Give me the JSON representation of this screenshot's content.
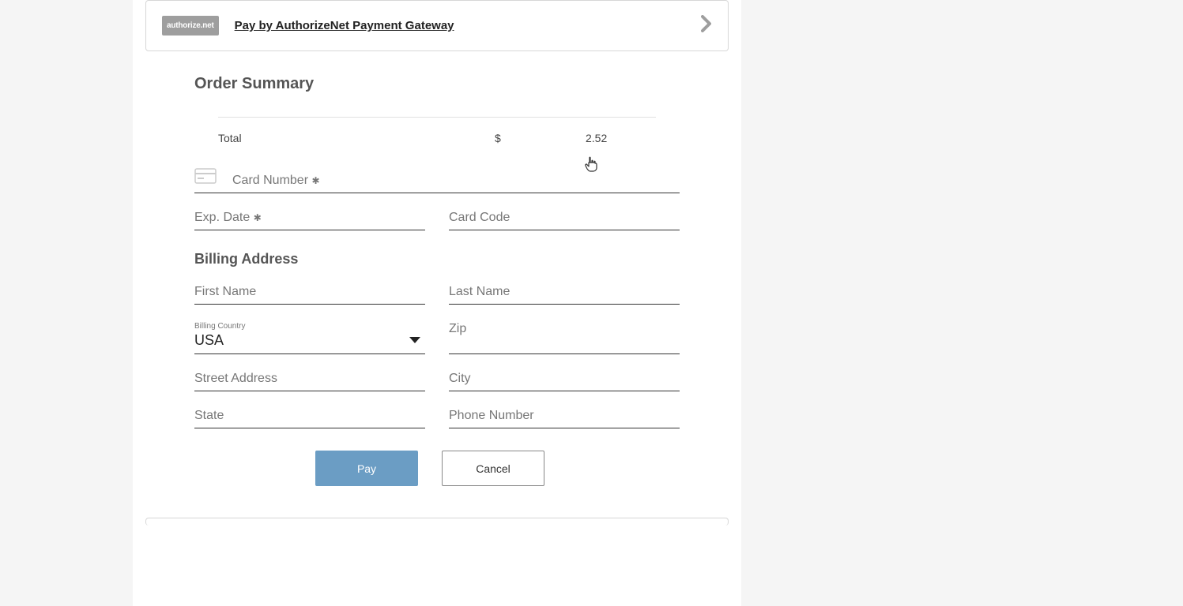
{
  "gateway": {
    "badge_text": "authorize.net",
    "title": "Pay by AuthorizeNet Payment Gateway"
  },
  "order_summary": {
    "heading": "Order Summary",
    "total_label": "Total",
    "currency": "$",
    "amount": "2.52"
  },
  "card_form": {
    "card_number_label": "Card Number",
    "required_mark": "✱",
    "exp_date_label": "Exp. Date",
    "card_code_label": "Card Code"
  },
  "billing": {
    "heading": "Billing Address",
    "first_name_label": "First Name",
    "last_name_label": "Last Name",
    "country_label": "Billing Country",
    "country_value": "USA",
    "zip_label": "Zip",
    "street_label": "Street Address",
    "city_label": "City",
    "state_label": "State",
    "phone_label": "Phone Number"
  },
  "buttons": {
    "pay": "Pay",
    "cancel": "Cancel"
  }
}
